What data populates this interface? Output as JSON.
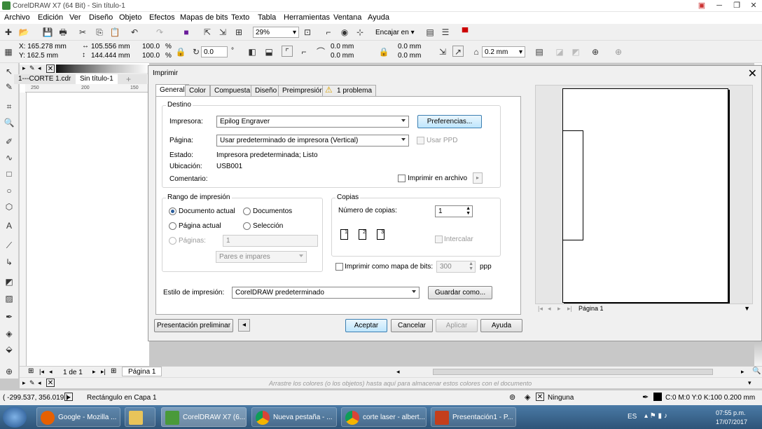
{
  "window": {
    "title": "CorelDRAW X7 (64 Bit) - Sin título-1"
  },
  "menu": [
    "Archivo",
    "Edición",
    "Ver",
    "Diseño",
    "Objeto",
    "Efectos",
    "Mapas de bits",
    "Texto",
    "Tabla",
    "Herramientas",
    "Ventana",
    "Ayuda"
  ],
  "toolbar": {
    "zoom": "29%",
    "snap": "Encajar en"
  },
  "property_bar": {
    "x": "X: 165.278 mm",
    "y": "Y: 162.5 mm",
    "w": "105.556 mm",
    "h": "144.444 mm",
    "sx": "100.0",
    "sy": "100.0",
    "pct": "%",
    "rot": "0.0",
    "deg": "°",
    "c1": "0.0 mm",
    "c2": "0.0 mm",
    "c3": "0.0 mm",
    "c4": "0.0 mm",
    "outline": "0.2 mm"
  },
  "doc_tabs": [
    "1---CORTE 1.cdr",
    "Sin título-1"
  ],
  "ruler": [
    "250",
    "200",
    "150"
  ],
  "dialog": {
    "title": "Imprimir",
    "tabs": [
      "General",
      "Color",
      "Compuesta",
      "Diseño",
      "Preimpresión",
      "1 problema"
    ],
    "destino": {
      "title": "Destino",
      "impresora_label": "Impresora:",
      "impresora": "Epilog Engraver",
      "preferencias": "Preferencias...",
      "pagina_label": "Página:",
      "pagina": "Usar predeterminado de impresora (Vertical)",
      "usar_ppd": "Usar PPD",
      "estado_label": "Estado:",
      "estado": "Impresora predeterminada; Listo",
      "ubicacion_label": "Ubicación:",
      "ubicacion": "USB001",
      "comentario_label": "Comentario:",
      "imprimir_archivo": "Imprimir en archivo"
    },
    "rango": {
      "title": "Rango de impresión",
      "doc_actual": "Documento actual",
      "documentos": "Documentos",
      "pagina_actual": "Página actual",
      "seleccion": "Selección",
      "paginas_label": "Páginas:",
      "paginas_val": "1",
      "pares": "Pares e impares"
    },
    "copias": {
      "title": "Copias",
      "num_label": "Número de copias:",
      "num": "1",
      "intercalar": "Intercalar",
      "p1": "1",
      "p2": "2",
      "p3": "3"
    },
    "bitmap": {
      "label": "Imprimir como mapa de bits:",
      "value": "300",
      "unit": "ppp"
    },
    "estilo": {
      "label": "Estilo de impresión:",
      "value": "CorelDRAW predeterminado",
      "guardar": "Guardar como..."
    },
    "buttons": {
      "preview": "Presentación preliminar",
      "aceptar": "Aceptar",
      "cancelar": "Cancelar",
      "aplicar": "Aplicar",
      "ayuda": "Ayuda"
    },
    "preview_page": "Página 1"
  },
  "page_nav": {
    "pages": "1 de 1",
    "tab": "Página 1"
  },
  "palette_hint": "Arrastre los colores (o los objetos) hasta aquí para almacenar estos colores con el documento",
  "status": {
    "coords": "( -299.537, 356.019 )",
    "object": "Rectángulo en Capa 1",
    "fill": "Ninguna",
    "outline": "C:0 M:0 Y:0 K:100  0.200 mm"
  },
  "taskbar": {
    "items": [
      "Google - Mozilla ...",
      "",
      "CorelDRAW X7 (6...",
      "Nueva pestaña - ...",
      "corte laser - albert...",
      "Presentación1 - P..."
    ],
    "lang": "ES",
    "time": "07:55 p.m.",
    "date": "17/07/2017"
  }
}
